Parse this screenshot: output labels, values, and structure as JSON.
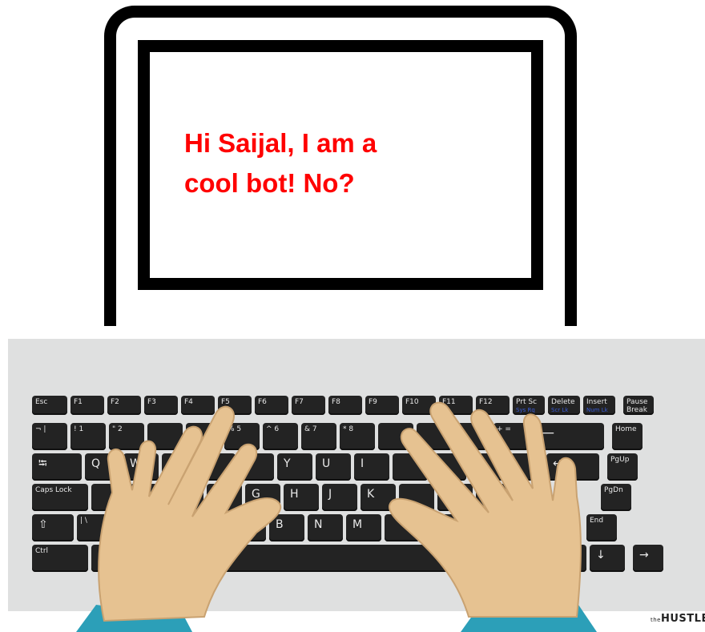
{
  "screen": {
    "message_line1": "Hi Saijal, I am a",
    "message_line2": "cool bot! No?",
    "message_color": "#ff0000"
  },
  "keyboard": {
    "row1": [
      "Esc",
      "F1",
      "F2",
      "F3",
      "F4",
      "F5",
      "F6",
      "F7",
      "F8",
      "F9",
      "F10",
      "F11",
      "F12",
      "Prt Sc",
      "Delete",
      "Insert",
      "Pause Break"
    ],
    "row1_alt": {
      "Prt Sc": "Sys Rq",
      "Delete": "Scr Lk",
      "Insert": "Num Lk"
    },
    "row2": [
      "¬ |",
      "! 1",
      "\" 2",
      "",
      "",
      "% 5",
      "^ 6",
      "& 7",
      "* 8",
      "",
      "",
      "",
      "",
      "+ =",
      "⟵",
      "Home"
    ],
    "row3": [
      "⭾",
      "Q",
      "W",
      "",
      "R",
      "T",
      "Y",
      "U",
      "I",
      "",
      "",
      "",
      "",
      "↵",
      "PgUp"
    ],
    "row4": [
      "Caps Lock",
      "",
      "",
      "",
      "F",
      "G",
      "H",
      "J",
      "K",
      "",
      "",
      "~ #",
      "",
      "PgDn"
    ],
    "row5": [
      "⇧",
      "| \\",
      "",
      "",
      "",
      "",
      "B",
      "N",
      "M",
      "",
      "",
      "⇧",
      "↑",
      "End"
    ],
    "row6": [
      "Ctrl",
      "",
      "",
      "",
      "",
      "",
      "",
      "←",
      "↓",
      "→"
    ]
  },
  "branding": {
    "logo_prefix": "the",
    "logo_text": "HUSTLE"
  },
  "colors": {
    "frame": "#000000",
    "desk": "#dfe0e0",
    "key": "#232323",
    "skin": "#e6c291",
    "sleeve": "#2c9fb8"
  }
}
